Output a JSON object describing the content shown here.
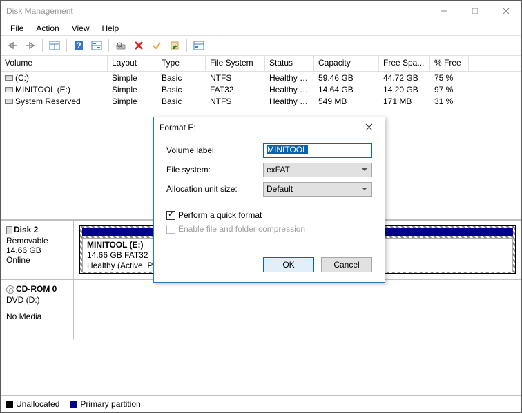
{
  "window": {
    "title": "Disk Management"
  },
  "menu": {
    "file": "File",
    "action": "Action",
    "view": "View",
    "help": "Help"
  },
  "table": {
    "headers": [
      "Volume",
      "Layout",
      "Type",
      "File System",
      "Status",
      "Capacity",
      "Free Spa...",
      "% Free"
    ],
    "rows": [
      {
        "vol": "(C:)",
        "layout": "Simple",
        "type": "Basic",
        "fs": "NTFS",
        "status": "Healthy (B...",
        "cap": "59.46 GB",
        "free": "44.72 GB",
        "pct": "75 %"
      },
      {
        "vol": "MINITOOL (E:)",
        "layout": "Simple",
        "type": "Basic",
        "fs": "FAT32",
        "status": "Healthy (A...",
        "cap": "14.64 GB",
        "free": "14.20 GB",
        "pct": "97 %"
      },
      {
        "vol": "System Reserved",
        "layout": "Simple",
        "type": "Basic",
        "fs": "NTFS",
        "status": "Healthy (S...",
        "cap": "549 MB",
        "free": "171 MB",
        "pct": "31 %"
      }
    ]
  },
  "disks": [
    {
      "name": "Disk 2",
      "info1": "Removable",
      "info2": "14.66 GB",
      "info3": "Online",
      "type": "disk",
      "partitions": [
        {
          "title": "MINITOOL  (E:)",
          "line2": "14.66 GB FAT32",
          "line3": "Healthy (Active, Primary Partition)"
        }
      ]
    },
    {
      "name": "CD-ROM 0",
      "info1": "DVD (D:)",
      "info2": "",
      "info3": "No Media",
      "type": "cd",
      "partitions": []
    }
  ],
  "legend": {
    "unallocated": "Unallocated",
    "primary": "Primary partition"
  },
  "dialog": {
    "title": "Format E:",
    "labels": {
      "volume": "Volume label:",
      "fs": "File system:",
      "aus": "Allocation unit size:"
    },
    "values": {
      "volume": "MINITOOL",
      "fs": "exFAT",
      "aus": "Default"
    },
    "quick": "Perform a quick format",
    "compress": "Enable file and folder compression",
    "ok": "OK",
    "cancel": "Cancel"
  }
}
